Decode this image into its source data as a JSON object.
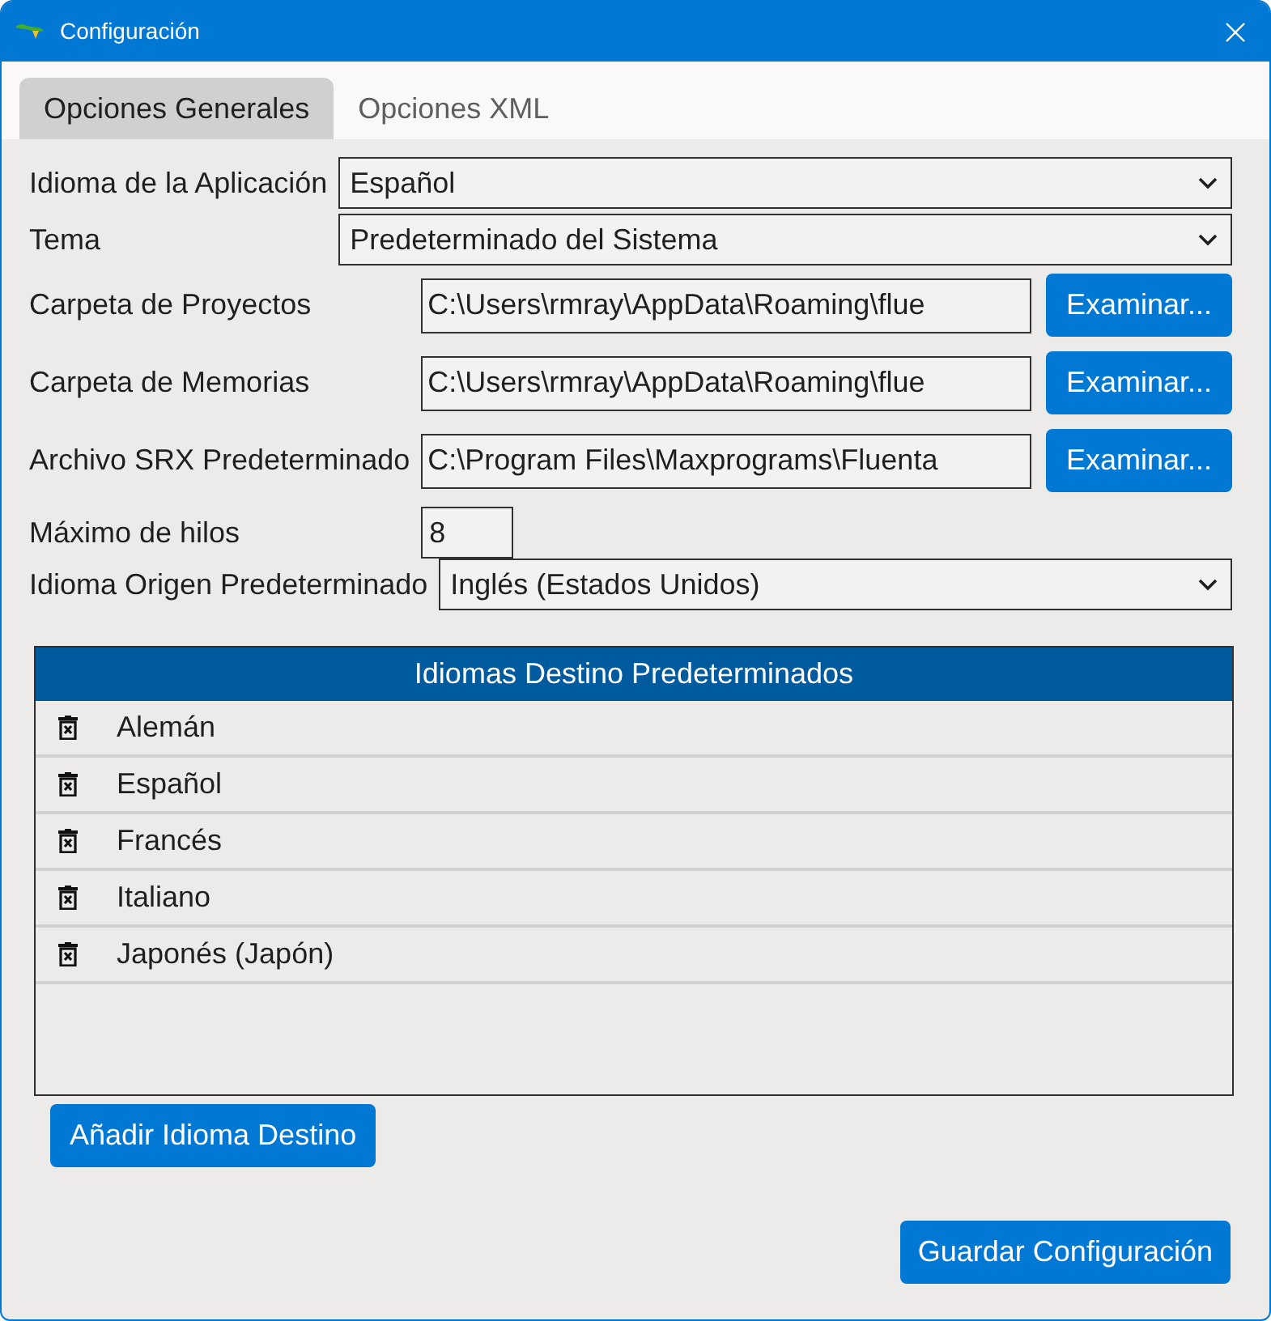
{
  "window": {
    "title": "Configuración"
  },
  "tabs": [
    {
      "label": "Opciones Generales",
      "selected": true
    },
    {
      "label": "Opciones XML",
      "selected": false
    }
  ],
  "settings": [
    {
      "kind": "select",
      "label": "Idioma de la Aplicación",
      "value": "Español"
    },
    {
      "kind": "select",
      "label": "Tema",
      "value": "Predeterminado del Sistema"
    },
    {
      "kind": "path",
      "label": "Carpeta de Proyectos",
      "value": "C:\\Users\\rmray\\AppData\\Roaming\\flue",
      "button": "Examinar..."
    },
    {
      "kind": "path",
      "label": "Carpeta de Memorias",
      "value": "C:\\Users\\rmray\\AppData\\Roaming\\flue",
      "button": "Examinar..."
    },
    {
      "kind": "path",
      "label": "Archivo SRX Predeterminado",
      "value": "C:\\Program Files\\Maxprograms\\Fluenta",
      "button": "Examinar..."
    },
    {
      "kind": "number",
      "label": "Máximo de hilos",
      "value": "8"
    },
    {
      "kind": "select",
      "label": "Idioma Origen Predeterminado",
      "value": "Inglés (Estados Unidos)"
    }
  ],
  "target_languages": {
    "title": "Idiomas Destino Predeterminados",
    "rows": [
      "Alemán",
      "Español",
      "Francés",
      "Italiano",
      "Japonés (Japón)"
    ]
  },
  "buttons": {
    "add": "Añadir Idioma Destino",
    "save": "Guardar Configuración"
  }
}
